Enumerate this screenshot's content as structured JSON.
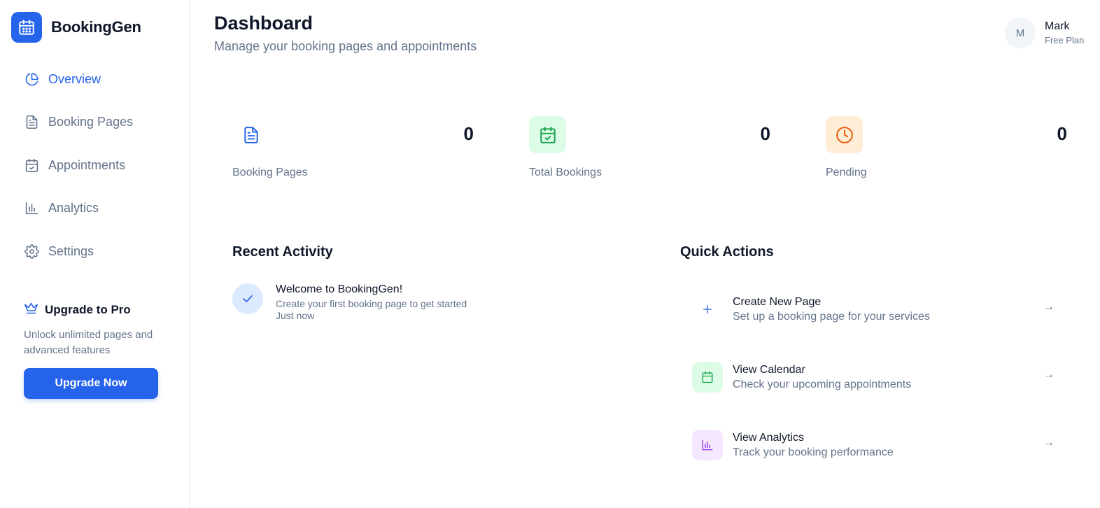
{
  "brand": {
    "name": "BookingGen",
    "icon": "calendar-icon",
    "color": "#2563eb"
  },
  "sidebar": {
    "items": [
      {
        "label": "Overview",
        "icon": "pie-chart-icon",
        "active": true
      },
      {
        "label": "Booking Pages",
        "icon": "file-text-icon",
        "active": false
      },
      {
        "label": "Appointments",
        "icon": "calendar-check-icon",
        "active": false
      },
      {
        "label": "Analytics",
        "icon": "bar-chart-icon",
        "active": false
      },
      {
        "label": "Settings",
        "icon": "gear-icon",
        "active": false
      }
    ],
    "upgrade": {
      "icon": "crown-icon",
      "title": "Upgrade to Pro",
      "description": "Unlock unlimited pages and advanced features",
      "button": "Upgrade Now"
    }
  },
  "header": {
    "title": "Dashboard",
    "subtitle": "Manage your booking pages and appointments"
  },
  "user": {
    "initial": "M",
    "name": "Mark",
    "plan": "Free Plan"
  },
  "stats": [
    {
      "label": "Booking Pages",
      "value": "0",
      "icon": "file-text-icon",
      "color": "#2563eb"
    },
    {
      "label": "Total Bookings",
      "value": "0",
      "icon": "calendar-check-icon",
      "color": "#16a34a"
    },
    {
      "label": "Pending",
      "value": "0",
      "icon": "clock-icon",
      "color": "#ea580c"
    }
  ],
  "recent_activity": {
    "title": "Recent Activity",
    "items": [
      {
        "icon": "check-icon",
        "title": "Welcome to BookingGen!",
        "description": "Create your first booking page to get started",
        "time": "Just now"
      }
    ]
  },
  "quick_actions": {
    "title": "Quick Actions",
    "items": [
      {
        "title": "Create New Page",
        "description": "Set up a booking page for your services",
        "icon": "plus-icon",
        "arrow": "→"
      },
      {
        "title": "View Calendar",
        "description": "Check your upcoming appointments",
        "icon": "calendar-icon",
        "arrow": "→"
      },
      {
        "title": "View Analytics",
        "description": "Track your booking performance",
        "icon": "bar-chart-icon",
        "arrow": "→"
      }
    ]
  }
}
